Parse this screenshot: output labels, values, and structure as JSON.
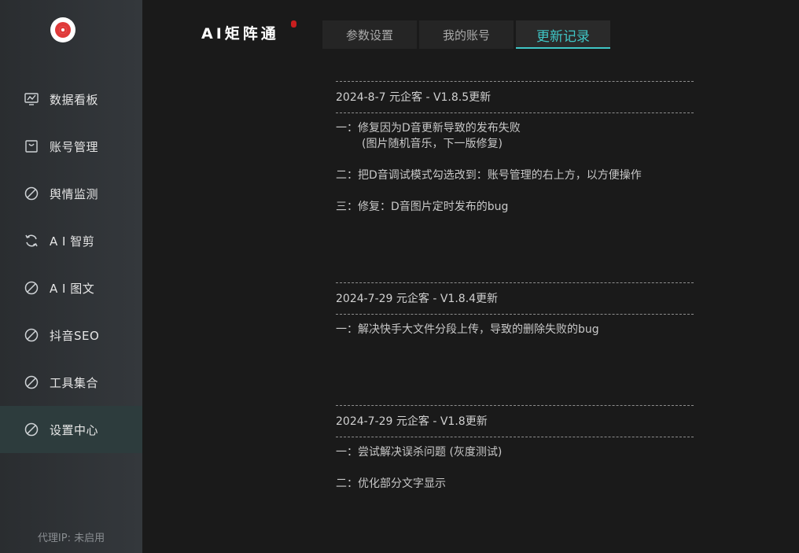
{
  "app": {
    "brand": "AI矩阵通",
    "accent_color": "#3fc6c6"
  },
  "sidebar": {
    "logo_icon": "target-logo-icon",
    "items": [
      {
        "label": "数据看板",
        "icon": "monitor-chart-icon"
      },
      {
        "label": "账号管理",
        "icon": "bag-icon"
      },
      {
        "label": "舆情监测",
        "icon": "circle-slash-icon"
      },
      {
        "label": "A I 智剪",
        "icon": "refresh-cycle-icon"
      },
      {
        "label": "A I 图文",
        "icon": "circle-slash-icon"
      },
      {
        "label": "抖音SEO",
        "icon": "circle-slash-icon"
      },
      {
        "label": "工具集合",
        "icon": "circle-slash-icon"
      },
      {
        "label": "设置中心",
        "icon": "circle-slash-icon",
        "active": true
      }
    ],
    "proxy_status": "代理IP: 未启用"
  },
  "tabs": [
    {
      "label": "参数设置"
    },
    {
      "label": "我的账号"
    },
    {
      "label": "更新记录",
      "active": true
    }
  ],
  "changelog": [
    {
      "title": "2024-8-7 元企客 - V1.8.5更新",
      "lines": [
        {
          "text": "一：修复因为D音更新导致的发布失败"
        },
        {
          "text": "(图片随机音乐，下一版修复)",
          "sub": true
        },
        {
          "text": ""
        },
        {
          "text": "二：把D音调试模式勾选改到：账号管理的右上方，以方便操作"
        },
        {
          "text": ""
        },
        {
          "text": "三：修复：D音图片定时发布的bug"
        }
      ]
    },
    {
      "title": "2024-7-29 元企客 - V1.8.4更新",
      "lines": [
        {
          "text": "一：解决快手大文件分段上传，导致的删除失败的bug"
        }
      ]
    },
    {
      "title": "2024-7-29 元企客 - V1.8更新",
      "lines": [
        {
          "text": "一：尝试解决误杀问题  (灰度测试)"
        },
        {
          "text": ""
        },
        {
          "text": "二：优化部分文字显示"
        }
      ]
    }
  ]
}
